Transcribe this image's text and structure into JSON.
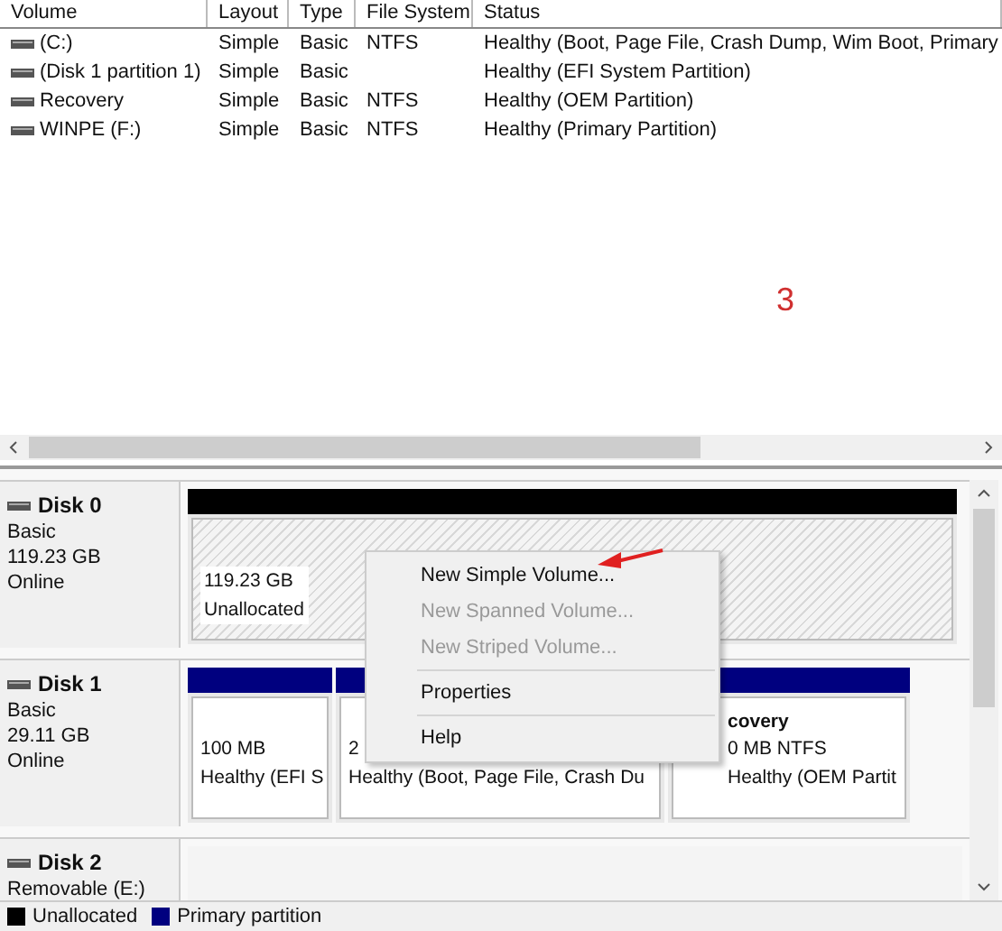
{
  "volume_table": {
    "columns": [
      "Volume",
      "Layout",
      "Type",
      "File System",
      "Status"
    ],
    "rows": [
      {
        "cells": [
          " (C:)",
          "Simple",
          "Basic",
          "NTFS",
          "Healthy (Boot, Page File, Crash Dump, Wim Boot, Primary"
        ]
      },
      {
        "cells": [
          "(Disk 1 partition 1)",
          "Simple",
          "Basic",
          "",
          "Healthy (EFI System Partition)"
        ]
      },
      {
        "cells": [
          "Recovery",
          "Simple",
          "Basic",
          "NTFS",
          "Healthy (OEM Partition)"
        ]
      },
      {
        "cells": [
          "WINPE (F:)",
          "Simple",
          "Basic",
          "NTFS",
          "Healthy (Primary Partition)"
        ]
      }
    ],
    "annotation": "3"
  },
  "disks": [
    {
      "name": "Disk 0",
      "lines": [
        "Basic",
        "119.23 GB",
        "Online"
      ],
      "partitions": [
        {
          "kind": "unallocated",
          "lines": [
            "119.23 GB",
            "Unallocated"
          ]
        }
      ]
    },
    {
      "name": "Disk 1",
      "lines": [
        "Basic",
        "29.11 GB",
        "Online"
      ],
      "partitions": [
        {
          "kind": "primary",
          "lines": [
            "100 MB",
            "Healthy (EFI S"
          ]
        },
        {
          "kind": "primary",
          "lines": [
            "2",
            "Healthy (Boot, Page File, Crash Du"
          ]
        },
        {
          "kind": "primary",
          "title": "covery",
          "lines": [
            "0 MB NTFS",
            "Healthy (OEM Partit"
          ]
        }
      ]
    },
    {
      "name": "Disk 2",
      "lines": [
        "Removable (E:)"
      ]
    }
  ],
  "context_menu": {
    "items": [
      {
        "kind": "item",
        "label": "New Simple Volume...",
        "disabled": false
      },
      {
        "kind": "item",
        "label": "New Spanned Volume...",
        "disabled": true
      },
      {
        "kind": "item",
        "label": "New Striped Volume...",
        "disabled": true
      },
      {
        "kind": "separator"
      },
      {
        "kind": "item",
        "label": "Properties",
        "disabled": false
      },
      {
        "kind": "separator"
      },
      {
        "kind": "item",
        "label": "Help",
        "disabled": false
      }
    ]
  },
  "legend": [
    {
      "label": "Unallocated",
      "color": "#000000"
    },
    {
      "label": "Primary partition",
      "color": "#00007f"
    }
  ]
}
